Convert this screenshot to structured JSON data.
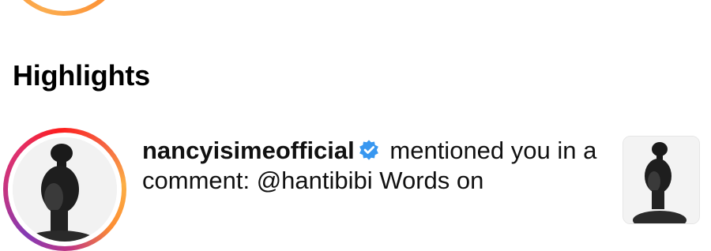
{
  "section": {
    "title": "Highlights"
  },
  "notification": {
    "username": "nancyisimeofficial",
    "action_text": " mentioned you in a comment: @hantibibi Words on"
  },
  "icons": {
    "verified": "verified-badge-icon"
  },
  "colors": {
    "verified_blue": "#3897f0",
    "ring_gradient": [
      "#833ab4",
      "#c13584",
      "#e1306c",
      "#fd1d1d",
      "#f56040",
      "#fcaf45"
    ]
  }
}
